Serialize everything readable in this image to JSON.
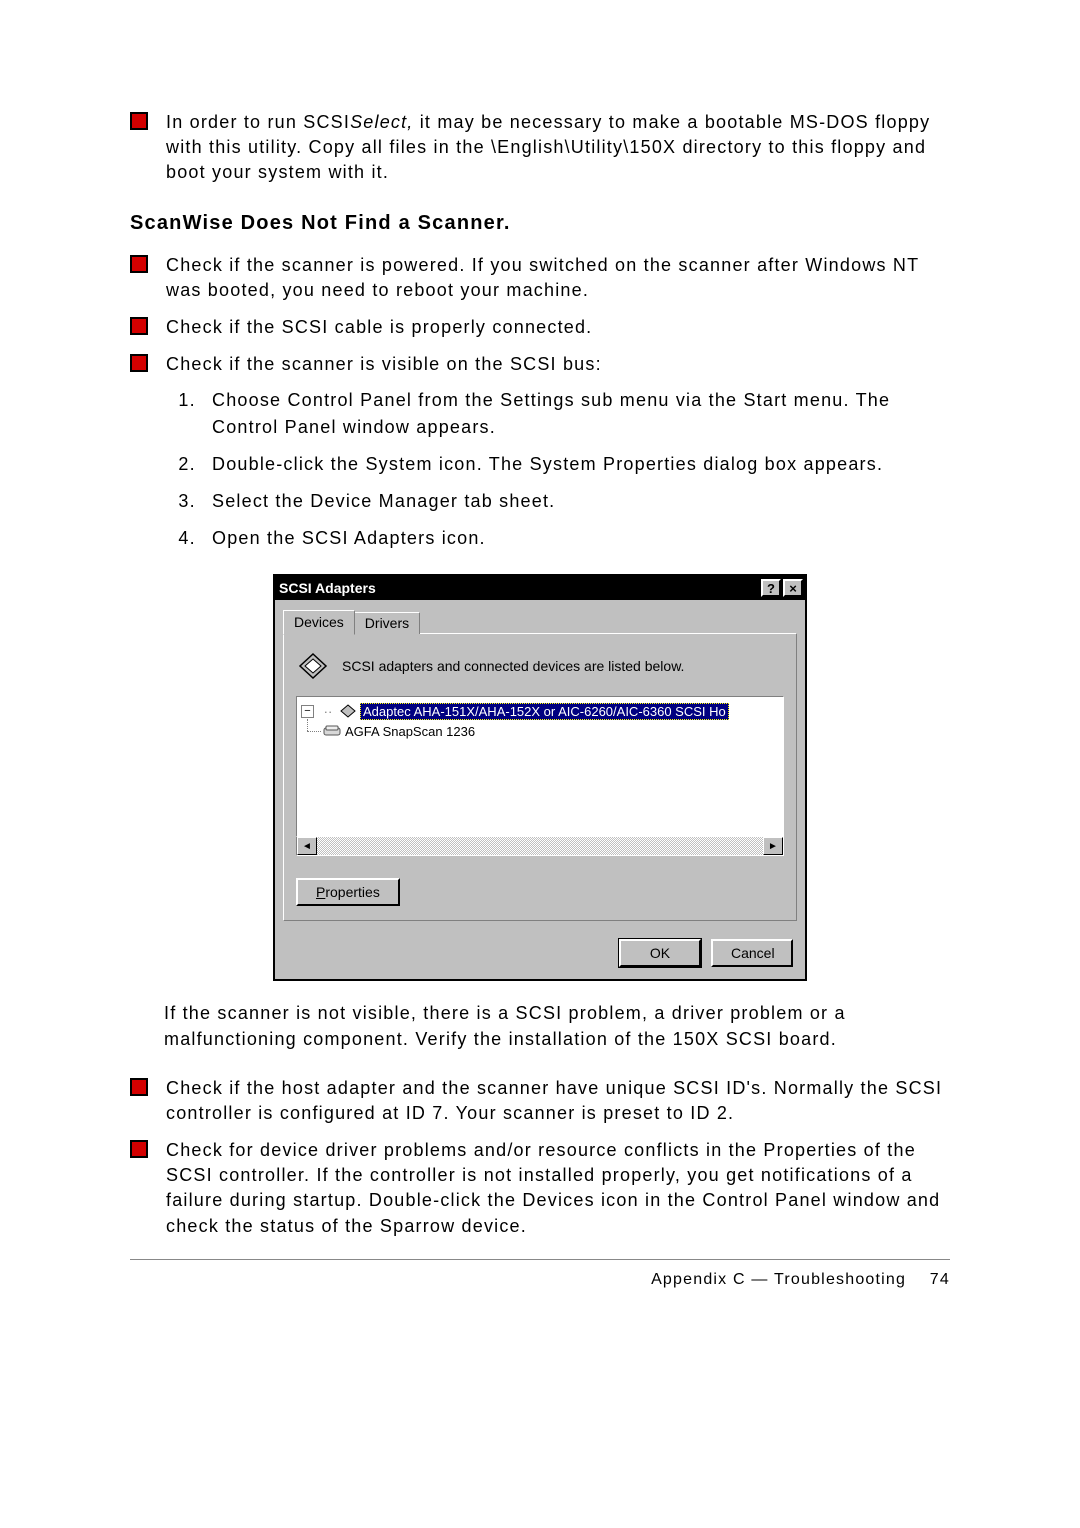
{
  "bullets": {
    "intro_before_italic": "In order to run SCSI",
    "intro_italic": "Select,",
    "intro_after_italic": " it may be necessary to make a bootable MS-DOS floppy with this utility. Copy all files in the \\English\\Utility\\150X directory to this floppy and boot your system with it.",
    "b1": "Check if the scanner is powered. If you switched on the scanner after Windows NT was booted, you need to reboot your machine.",
    "b2": "Check if the SCSI cable is properly connected.",
    "b3": "Check if the scanner is visible on the SCSI bus:",
    "after_img": "If the scanner is not visible, there is a SCSI problem, a driver problem or a malfunctioning component. Verify the installation of the 150X SCSI board.",
    "b4": "Check if the host adapter and the scanner have unique SCSI ID's. Normally the SCSI controller is configured at ID 7. Your scanner is preset to ID 2.",
    "b5": "Check for device driver problems and/or resource conflicts in the Properties of the SCSI controller. If the controller is not installed properly, you get notifications of a failure during startup. Double-click the Devices icon in the Control Panel window and check the status of the Sparrow device."
  },
  "section_heading": "ScanWise Does Not Find a Scanner.",
  "steps": {
    "s1": "Choose Control Panel from the Settings sub menu via the Start menu. The Control Panel window appears.",
    "s2": "Double-click the System icon. The System Properties dialog box appears.",
    "s3": "Select the Device Manager tab sheet.",
    "s4": "Open the SCSI Adapters icon."
  },
  "dialog": {
    "title": "SCSI Adapters",
    "help_glyph": "?",
    "close_glyph": "×",
    "tabs": {
      "devices": "Devices",
      "drivers": "Drivers"
    },
    "panel_msg": "SCSI adapters and connected devices are listed below.",
    "tree": {
      "expand_glyph": "−",
      "root": "Adaptec AHA-151X/AHA-152X or AIC-6260/AIC-6360 SCSI Ho",
      "child": "AGFA SnapScan 1236"
    },
    "scroll": {
      "left": "◄",
      "right": "►"
    },
    "buttons": {
      "properties_u": "P",
      "properties_rest": "roperties",
      "ok": "OK",
      "cancel": "Cancel"
    }
  },
  "footer": {
    "label": "Appendix C — Troubleshooting",
    "page": "74"
  }
}
